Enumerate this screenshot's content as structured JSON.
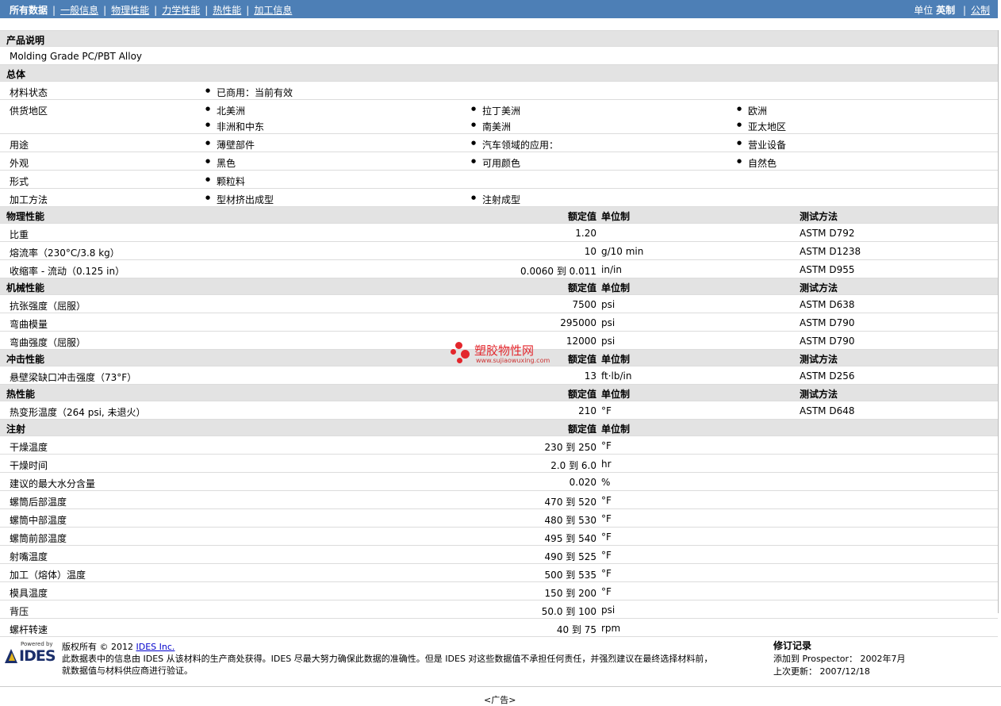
{
  "nav": {
    "all": "所有数据",
    "items": [
      "一般信息",
      "物理性能",
      "力学性能",
      "热性能",
      "加工信息"
    ],
    "units_label": "单位",
    "units_current": "英制",
    "units_other": "公制"
  },
  "desc": {
    "title": "产品说明",
    "text": "Molding Grade PC/PBT Alloy"
  },
  "general": {
    "title": "总体",
    "status": {
      "label": "材料状态",
      "value": "已商用：当前有效"
    },
    "regions": {
      "label": "供货地区",
      "values": [
        "北美洲",
        "拉丁美洲",
        "欧洲",
        "非洲和中东",
        "南美洲",
        "亚太地区"
      ]
    },
    "uses": {
      "label": "用途",
      "values": [
        "薄壁部件",
        "汽车领域的应用：",
        "营业设备"
      ]
    },
    "look": {
      "label": "外观",
      "values": [
        "黑色",
        "可用颜色",
        "自然色"
      ]
    },
    "form": {
      "label": "形式",
      "values": [
        "颗粒料"
      ]
    },
    "process": {
      "label": "加工方法",
      "values": [
        "型材挤出成型",
        "注射成型"
      ]
    }
  },
  "cols": {
    "value": "额定值",
    "unit": "单位制",
    "method": "测试方法"
  },
  "physical": {
    "title": "物理性能",
    "rows": [
      {
        "label": "比重",
        "value": "1.20",
        "unit": "",
        "method": "ASTM D792"
      },
      {
        "label": "熔流率（230°C/3.8 kg）",
        "value": "10",
        "unit": "g/10 min",
        "method": "ASTM D1238"
      },
      {
        "label": "收缩率 - 流动（0.125 in）",
        "value": "0.0060 到  0.011",
        "unit": "in/in",
        "method": "ASTM D955"
      }
    ]
  },
  "mechanical": {
    "title": "机械性能",
    "rows": [
      {
        "label": "抗张强度（屈服）",
        "value": "7500",
        "unit": "psi",
        "method": "ASTM D638"
      },
      {
        "label": "弯曲模量",
        "value": "295000",
        "unit": "psi",
        "method": "ASTM D790"
      },
      {
        "label": "弯曲强度（屈服）",
        "value": "12000",
        "unit": "psi",
        "method": "ASTM D790"
      }
    ]
  },
  "impact": {
    "title": "冲击性能",
    "rows": [
      {
        "label": "悬壁梁缺口冲击强度（73°F）",
        "value": "13",
        "unit": "ft·lb/in",
        "method": "ASTM D256"
      }
    ]
  },
  "thermal": {
    "title": "热性能",
    "rows": [
      {
        "label": "热变形温度（264 psi, 未退火）",
        "value": "210",
        "unit": "°F",
        "method": "ASTM D648"
      }
    ]
  },
  "injection": {
    "title": "注射",
    "rows": [
      {
        "label": "干燥温度",
        "value": "230 到  250",
        "unit": "°F"
      },
      {
        "label": "干燥时间",
        "value": "2.0 到  6.0",
        "unit": "hr"
      },
      {
        "label": "建议的最大水分含量",
        "value": "0.020",
        "unit": "%"
      },
      {
        "label": "螺筒后部温度",
        "value": "470 到  520",
        "unit": "°F"
      },
      {
        "label": "螺筒中部温度",
        "value": "480 到  530",
        "unit": "°F"
      },
      {
        "label": "螺筒前部温度",
        "value": "495 到  540",
        "unit": "°F"
      },
      {
        "label": "射嘴温度",
        "value": "490 到  525",
        "unit": "°F"
      },
      {
        "label": "加工（熔体）温度",
        "value": "500 到  535",
        "unit": "°F"
      },
      {
        "label": "模具温度",
        "value": "150 到  200",
        "unit": "°F"
      },
      {
        "label": "背压",
        "value": "50.0 到  100",
        "unit": "psi"
      },
      {
        "label": "螺杆转速",
        "value": "40 到  75",
        "unit": "rpm"
      }
    ]
  },
  "footer": {
    "powered": "Powered by",
    "logo": "IDES",
    "copyright": "版权所有 © 2012",
    "company": "IDES Inc.",
    "line2": "此数据表中的信息由 IDES 从该材料的生产商处获得。IDES 尽最大努力确保此数据的准确性。但是 IDES 对这些数据值不承担任何责任，并强烈建议在最终选择材料前，",
    "line3": "就数据值与材料供应商进行验证。",
    "rev_title": "修订记录",
    "added_label": "添加到 Prospector：",
    "added_value": "2002年7月",
    "updated_label": "上次更新：",
    "updated_value": "2007/12/18"
  },
  "watermark": {
    "text": "塑胶物性网",
    "url": "www.sujiaowuxing.com"
  },
  "ad": "<广告>"
}
